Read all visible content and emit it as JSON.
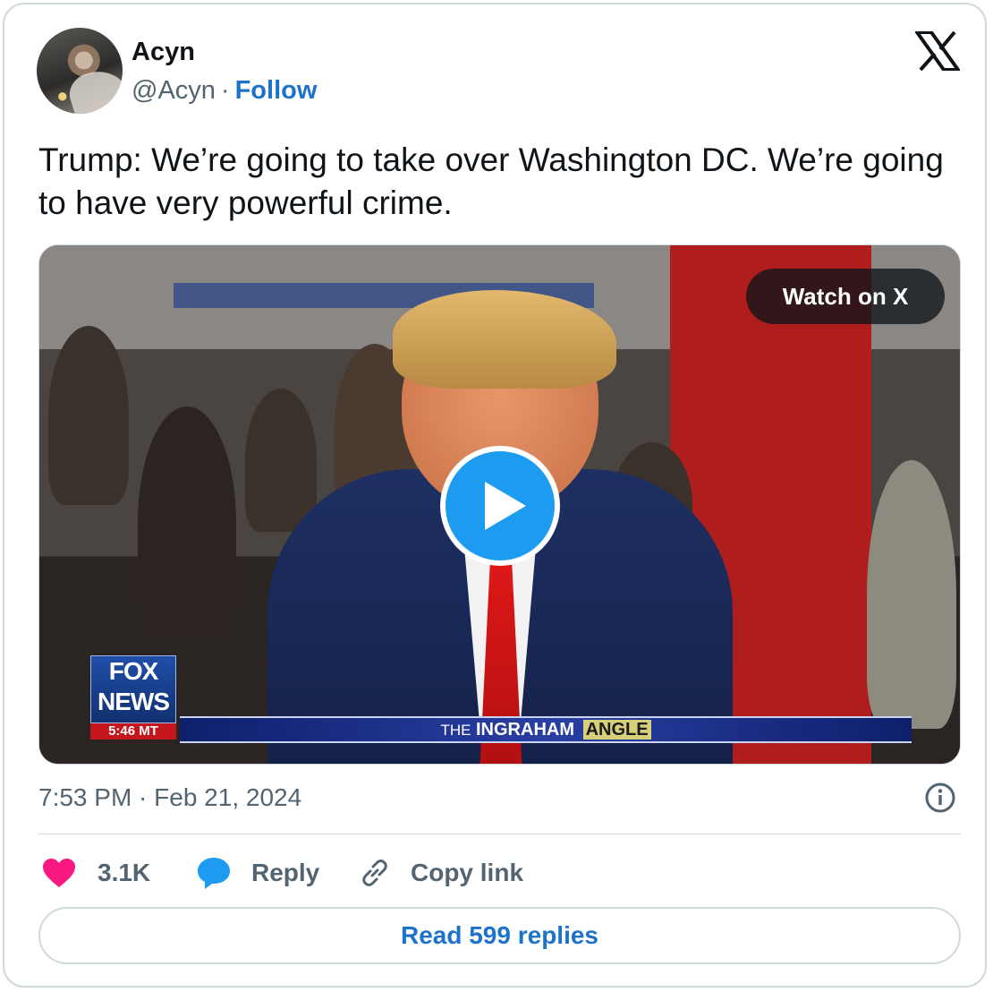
{
  "author": {
    "name": "Acyn",
    "handle": "@Acyn",
    "separator": "·",
    "follow_label": "Follow"
  },
  "tweet": {
    "text": "Trump: We’re going to take over Washington DC. We’re going to have very powerful crime."
  },
  "media": {
    "watch_label": "Watch on X",
    "fox_line1": "FOX",
    "fox_line2": "NEWS",
    "fox_time": "5:46 MT",
    "show_prefix": "THE",
    "show_name": "INGRAHAM",
    "show_suffix": "ANGLE"
  },
  "meta": {
    "timestamp": "7:53 PM · Feb 21, 2024"
  },
  "actions": {
    "likes": "3.1K",
    "reply_label": "Reply",
    "copy_label": "Copy link"
  },
  "footer": {
    "read_replies_label": "Read 599 replies"
  },
  "colors": {
    "accent": "#1d9bf0",
    "link": "#1d73c9",
    "like": "#f91880",
    "muted": "#536471",
    "border": "#cfd9de"
  }
}
